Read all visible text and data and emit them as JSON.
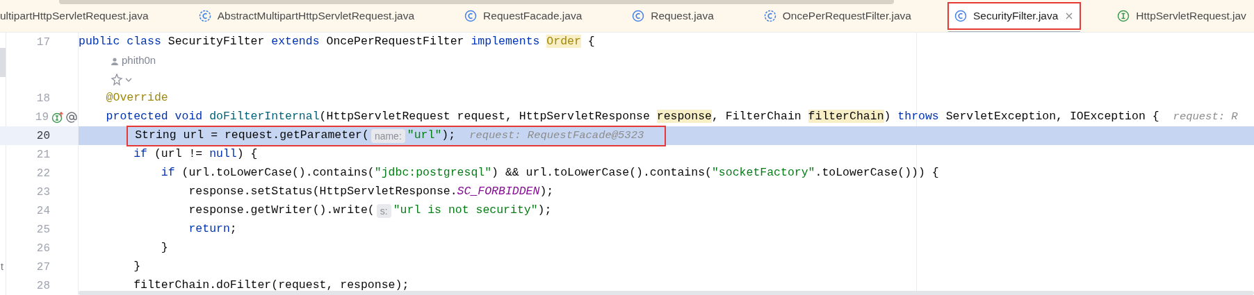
{
  "tabs": [
    {
      "label": "ultipartHttpServletRequest.java",
      "kind": "plain",
      "selected": false
    },
    {
      "label": "AbstractMultipartHttpServletRequest.java",
      "kind": "abstract",
      "selected": false
    },
    {
      "label": "RequestFacade.java",
      "kind": "class",
      "selected": false
    },
    {
      "label": "Request.java",
      "kind": "class",
      "selected": false
    },
    {
      "label": "OncePerRequestFilter.java",
      "kind": "abstract",
      "selected": false
    },
    {
      "label": "SecurityFilter.java",
      "kind": "class",
      "selected": true,
      "framed": true
    },
    {
      "label": "HttpServletRequest.jav",
      "kind": "interface",
      "selected": false
    }
  ],
  "editor": {
    "lines": [
      {
        "kind": "code",
        "number": "17",
        "tokens": [
          {
            "t": "public class ",
            "kind": "keyword"
          },
          {
            "t": "SecurityFilter ",
            "kind": "plain"
          },
          {
            "t": "extends ",
            "kind": "keyword"
          },
          {
            "t": "OncePerRequestFilter ",
            "kind": "plain"
          },
          {
            "t": "implements ",
            "kind": "keyword"
          },
          {
            "t": "Order",
            "kind": "type_usage"
          },
          {
            "t": " {",
            "kind": "plain"
          }
        ]
      },
      {
        "kind": "author",
        "text": "phith0n"
      },
      {
        "kind": "actions"
      },
      {
        "kind": "code",
        "number": "18",
        "tokens": [
          {
            "t": "    @Override",
            "kind": "annotation"
          }
        ]
      },
      {
        "kind": "code",
        "number": "19",
        "gutter_icons": true,
        "tokens": [
          {
            "t": "    protected void ",
            "kind": "keyword"
          },
          {
            "t": "doFilterInternal",
            "kind": "method"
          },
          {
            "t": "(HttpServletRequest request, HttpServletResponse ",
            "kind": "plain"
          },
          {
            "t": "response",
            "kind": "usage"
          },
          {
            "t": ", FilterChain ",
            "kind": "plain"
          },
          {
            "t": "filterChain",
            "kind": "usage"
          },
          {
            "t": ") ",
            "kind": "plain"
          },
          {
            "t": "throws ",
            "kind": "keyword"
          },
          {
            "t": "ServletException, IOException {",
            "kind": "plain"
          },
          {
            "t": "request: R",
            "kind": "value_hint"
          }
        ]
      },
      {
        "kind": "code",
        "number": "20",
        "current": true,
        "framed": true,
        "tokens": [
          {
            "t": "        String url = request.getParameter(",
            "kind": "plain"
          },
          {
            "t": "name:",
            "kind": "param_hint"
          },
          {
            "t": "\"url\"",
            "kind": "string"
          },
          {
            "t": ");",
            "kind": "plain"
          },
          {
            "t": "request: RequestFacade@5323",
            "kind": "value_hint"
          }
        ]
      },
      {
        "kind": "code",
        "number": "21",
        "tokens": [
          {
            "t": "        if ",
            "kind": "keyword"
          },
          {
            "t": "(url != ",
            "kind": "plain"
          },
          {
            "t": "null",
            "kind": "keyword"
          },
          {
            "t": ") {",
            "kind": "plain"
          }
        ]
      },
      {
        "kind": "code",
        "number": "22",
        "tokens": [
          {
            "t": "            if ",
            "kind": "keyword"
          },
          {
            "t": "(url.toLowerCase().contains(",
            "kind": "plain"
          },
          {
            "t": "\"jdbc:postgresql\"",
            "kind": "string"
          },
          {
            "t": ") && url.toLowerCase().contains(",
            "kind": "plain"
          },
          {
            "t": "\"socketFactory\"",
            "kind": "string"
          },
          {
            "t": ".toLowerCase())) {",
            "kind": "plain"
          }
        ]
      },
      {
        "kind": "code",
        "number": "23",
        "tokens": [
          {
            "t": "                response.setStatus(HttpServletResponse.",
            "kind": "plain"
          },
          {
            "t": "SC_FORBIDDEN",
            "kind": "field"
          },
          {
            "t": ");",
            "kind": "plain"
          }
        ]
      },
      {
        "kind": "code",
        "number": "24",
        "tokens": [
          {
            "t": "                response.getWriter().write(",
            "kind": "plain"
          },
          {
            "t": "s:",
            "kind": "param_hint"
          },
          {
            "t": "\"url is not security\"",
            "kind": "string"
          },
          {
            "t": ");",
            "kind": "plain"
          }
        ]
      },
      {
        "kind": "code",
        "number": "25",
        "tokens": [
          {
            "t": "                return",
            "kind": "keyword"
          },
          {
            "t": ";",
            "kind": "plain"
          }
        ]
      },
      {
        "kind": "code",
        "number": "26",
        "tokens": [
          {
            "t": "            }",
            "kind": "plain"
          }
        ]
      },
      {
        "kind": "code",
        "number": "27",
        "edge_fragment": "t",
        "tokens": [
          {
            "t": "        }",
            "kind": "plain"
          }
        ]
      },
      {
        "kind": "code",
        "number": "28",
        "tokens": [
          {
            "t": "        filterChain.doFilter(request, response);",
            "kind": "plain"
          }
        ]
      }
    ]
  }
}
